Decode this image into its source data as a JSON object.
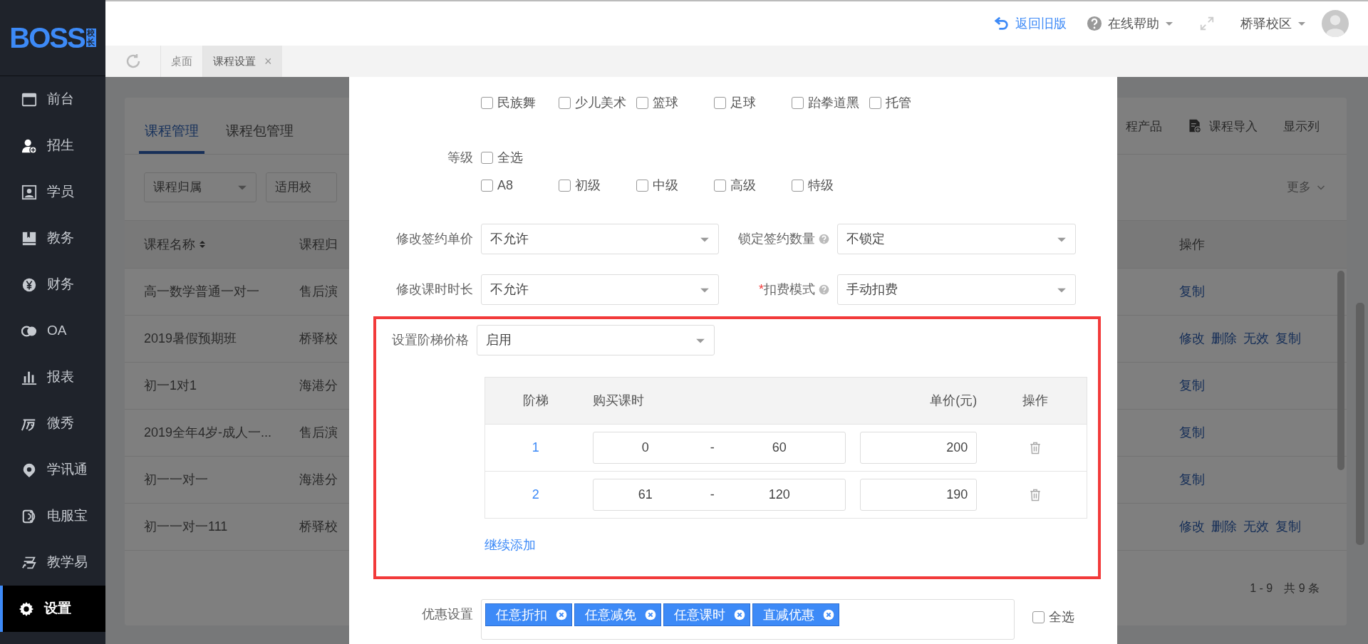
{
  "sidebar": {
    "logo": {
      "text": "BOSS",
      "badge": "校长"
    },
    "items": [
      {
        "label": "前台",
        "selected": false
      },
      {
        "label": "招生",
        "selected": false
      },
      {
        "label": "学员",
        "selected": false
      },
      {
        "label": "教务",
        "selected": false
      },
      {
        "label": "财务",
        "selected": false
      },
      {
        "label": "OA",
        "selected": false
      },
      {
        "label": "报表",
        "selected": false
      },
      {
        "label": "微秀",
        "selected": false
      },
      {
        "label": "学讯通",
        "selected": false
      },
      {
        "label": "电服宝",
        "selected": false
      },
      {
        "label": "教学易",
        "selected": false
      },
      {
        "label": "设置",
        "selected": true
      }
    ]
  },
  "header": {
    "back_link": "返回旧版",
    "help": "在线帮助",
    "campus": "桥驿校区"
  },
  "page_tabs": [
    {
      "label": "桌面",
      "selected": false
    },
    {
      "label": "课程设置",
      "selected": true,
      "close": "×"
    }
  ],
  "background": {
    "tabs": [
      {
        "label": "课程管理",
        "selected": true
      },
      {
        "label": "课程包管理",
        "selected": false
      }
    ],
    "toolbar": [
      "程产品",
      "课程导入",
      "显示列"
    ],
    "filters": [
      "课程归属",
      "适用校"
    ],
    "more": "更多",
    "table": {
      "columns": [
        "课程名称",
        "课程归",
        "操作"
      ],
      "rows": [
        {
          "name": "高一数学普通一对一",
          "owner": "售后演",
          "actions": [
            "复制"
          ]
        },
        {
          "name": "2019暑假预期班",
          "owner": "桥驿校",
          "actions": [
            "修改",
            "删除",
            "无效",
            "复制"
          ]
        },
        {
          "name": "初一1对1",
          "owner": "海港分",
          "actions": [
            "复制"
          ]
        },
        {
          "name": "2019全年4岁-成人一...",
          "owner": "售后演",
          "actions": [
            "复制"
          ]
        },
        {
          "name": "初一一对一",
          "owner": "海港分",
          "actions": [
            "复制"
          ]
        },
        {
          "name": "初一一对一111",
          "owner": "桥驿校",
          "actions": [
            "修改",
            "删除",
            "无效",
            "复制"
          ]
        }
      ]
    },
    "pagination": {
      "range": "1 - 9",
      "total": "共 9 条"
    }
  },
  "modal": {
    "subjects": [
      {
        "label": "民族舞",
        "checked": false
      },
      {
        "label": "少儿美术",
        "checked": false
      },
      {
        "label": "篮球",
        "checked": false
      },
      {
        "label": "足球",
        "checked": false
      },
      {
        "label": "跆拳道黑",
        "checked": false
      },
      {
        "label": "托管",
        "checked": false
      }
    ],
    "level": {
      "label": "等级",
      "select_all": {
        "label": "全选",
        "checked": false
      },
      "options": [
        {
          "label": "A8",
          "checked": false
        },
        {
          "label": "初级",
          "checked": false
        },
        {
          "label": "中级",
          "checked": false
        },
        {
          "label": "高级",
          "checked": false
        },
        {
          "label": "特级",
          "checked": false
        }
      ]
    },
    "fields": [
      {
        "label": "修改签约单价",
        "value": "不允许",
        "help": false
      },
      {
        "label": "锁定签约数量",
        "value": "不锁定",
        "help": true
      },
      {
        "label": "修改课时时长",
        "value": "不允许",
        "help": false
      },
      {
        "label": "扣费模式",
        "value": "手动扣费",
        "help": true,
        "marker": "*"
      }
    ],
    "tier_pricing": {
      "label": "设置阶梯价格",
      "value": "启用",
      "highlighted": true,
      "columns": [
        "阶梯",
        "购买课时",
        "单价(元)",
        "操作"
      ],
      "rows": [
        {
          "tier": "1",
          "from": "0",
          "sep": "-",
          "to": "60",
          "price": "200"
        },
        {
          "tier": "2",
          "from": "61",
          "sep": "-",
          "to": "120",
          "price": "190"
        }
      ],
      "add_link": "继续添加"
    },
    "discounts": {
      "label": "优惠设置",
      "tags": [
        "任意折扣",
        "任意减免",
        "任意课时",
        "直减优惠"
      ],
      "select_all": {
        "label": "全选",
        "checked": false
      }
    }
  }
}
